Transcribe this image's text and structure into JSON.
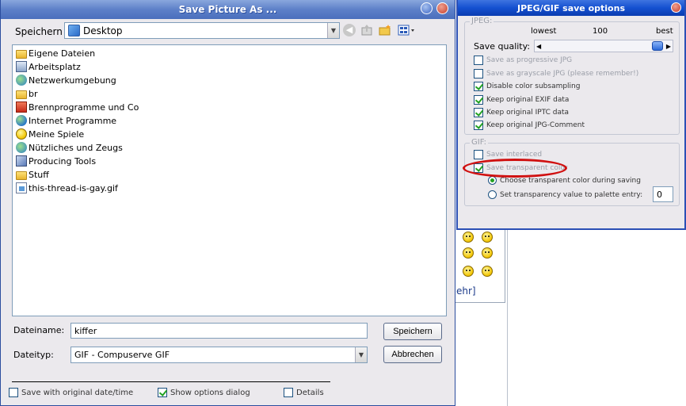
{
  "save_dialog": {
    "title": "Save Picture As ...",
    "save_in_label": "Speichern",
    "location": "Desktop",
    "files": [
      {
        "name": "Eigene Dateien",
        "icon": "folder-icon"
      },
      {
        "name": "Arbeitsplatz",
        "icon": "computer-icon"
      },
      {
        "name": "Netzwerkumgebung",
        "icon": "network-icon"
      },
      {
        "name": "br",
        "icon": "folder-icon"
      },
      {
        "name": "Brennprogramme und Co",
        "icon": "programs-icon"
      },
      {
        "name": "Internet Programme",
        "icon": "globe-icon"
      },
      {
        "name": "Meine Spiele",
        "icon": "smiley-icon"
      },
      {
        "name": "Nützliches und Zeugs",
        "icon": "network-icon"
      },
      {
        "name": "Producing Tools",
        "icon": "tools-icon"
      },
      {
        "name": "Stuff",
        "icon": "folder-icon"
      },
      {
        "name": "this-thread-is-gay.gif",
        "icon": "gif-file-icon"
      }
    ],
    "filename_label": "Dateiname:",
    "filename_value": "kiffer",
    "filetype_label": "Dateityp:",
    "filetype_value": "GIF - Compuserve GIF",
    "save_button": "Speichern",
    "cancel_button": "Abbrechen",
    "bottom_options": [
      {
        "label": "Save with original date/time",
        "checked": false
      },
      {
        "label": "Show options dialog",
        "checked": true
      },
      {
        "label": "Details",
        "checked": false
      }
    ]
  },
  "options_window": {
    "title": "JPEG/GIF save options",
    "jpeg_group_title": "JPEG:",
    "quality_low": "lowest",
    "quality_value": "100",
    "quality_high": "best",
    "quality_label": "Save quality:",
    "quality_level": 1.0,
    "jpeg_options": [
      {
        "label": "Save as progressive JPG",
        "checked": false
      },
      {
        "label": "Save as grayscale JPG (please remember!)",
        "checked": false
      },
      {
        "label": "Disable color subsampling",
        "checked": true
      },
      {
        "label": "Keep original EXIF data",
        "checked": true
      },
      {
        "label": "Keep original IPTC data",
        "checked": true
      },
      {
        "label": "Keep original JPG-Comment",
        "checked": true
      }
    ],
    "gif_group_title": "GIF:",
    "gif_options": [
      {
        "label": "Save interlaced",
        "checked": false
      },
      {
        "label": "Save transparent color",
        "checked": true
      }
    ],
    "transparency_choices": [
      {
        "label": "Choose transparent color during saving",
        "selected": true
      },
      {
        "label": "Set transparency value to palette entry:",
        "selected": false
      }
    ],
    "palette_entry_value": "0"
  },
  "background_page": {
    "more_link": "ehr]"
  },
  "colors": {
    "titlebar_blue": "#1450d0",
    "highlight_red": "#d01010",
    "check_green": "#21a121"
  }
}
